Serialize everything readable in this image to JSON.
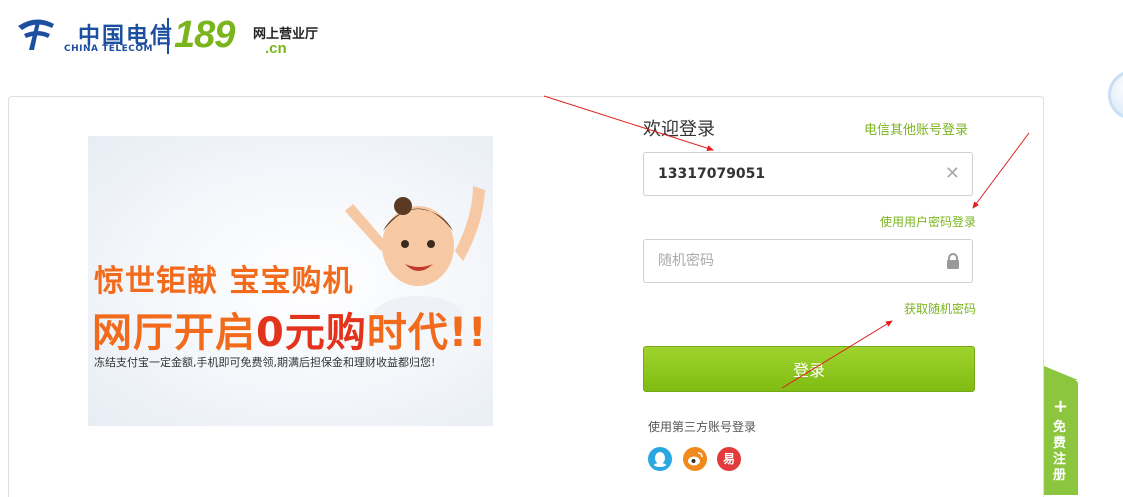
{
  "header": {
    "brand_cn": "中国电信",
    "brand_en": "CHINA TELECOM",
    "site_number": "189",
    "site_domain": ".cn",
    "site_name": "网上营业厅"
  },
  "banner": {
    "line1": "惊世钜献 宝宝购机",
    "line2_pre": "网厅开启",
    "line2_hl": "0元购",
    "line2_post": "时代!!",
    "line3": "冻结支付宝一定金额,手机即可免费领,期满后担保金和理财收益都归您!"
  },
  "login": {
    "welcome": "欢迎登录",
    "other_account_link": "电信其他账号登录",
    "phone_value": "13317079051",
    "user_password_link": "使用用户密码登录",
    "password_placeholder": "随机密码",
    "get_random_password_link": "获取随机密码",
    "login_button": "登录",
    "third_party_label": "使用第三方账号登录",
    "third_party": [
      {
        "name": "QQ",
        "icon": "qq-icon",
        "color": "#2aa7e0"
      },
      {
        "name": "微博",
        "icon": "weibo-icon",
        "color": "#f08a1d"
      },
      {
        "name": "易信",
        "icon": "yixin-icon",
        "color": "#e33b3b",
        "glyph": "易"
      }
    ]
  },
  "side": {
    "register_tab": "免费注册",
    "register_plus": "+"
  },
  "colors": {
    "brand_blue": "#1d4fa0",
    "accent_green": "#7ab51d",
    "banner_orange": "#f26b1d",
    "annotation_red": "#e02020"
  }
}
